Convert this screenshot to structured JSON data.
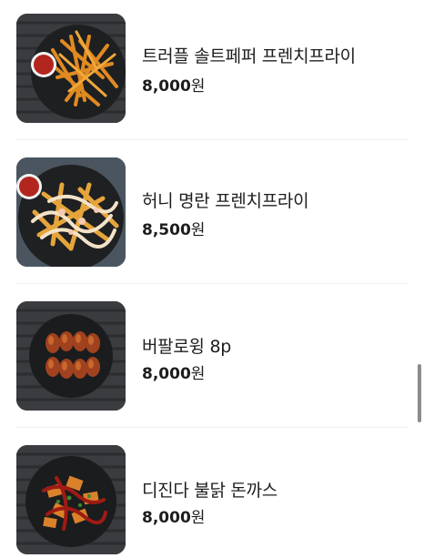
{
  "menu": {
    "items": [
      {
        "name": "트러플 솔트페퍼 프렌치프라이",
        "price": "8,000",
        "currency": "원",
        "image": "truffle-fries-photo"
      },
      {
        "name": "허니 명란 프렌치프라이",
        "price": "8,500",
        "currency": "원",
        "image": "honey-mentaiko-fries-photo"
      },
      {
        "name": "버팔로윙 8p",
        "price": "8,000",
        "currency": "원",
        "image": "buffalo-wings-photo"
      },
      {
        "name": "디진다 불닭 돈까스",
        "price": "8,000",
        "currency": "원",
        "image": "spicy-buldak-donkatsu-photo"
      }
    ]
  }
}
